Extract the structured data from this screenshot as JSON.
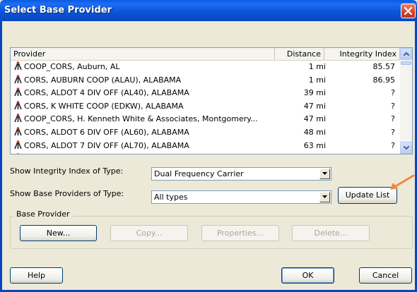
{
  "window": {
    "title": "Select Base Provider"
  },
  "list": {
    "columns": [
      "Provider",
      "Distance",
      "Integrity Index"
    ],
    "rows": [
      {
        "provider": "COOP_CORS, Auburn, AL",
        "distance": "1 mi",
        "integrity": "85.57"
      },
      {
        "provider": "CORS, AUBURN COOP (ALAU),  ALABAMA",
        "distance": "1 mi",
        "integrity": "86.95"
      },
      {
        "provider": "CORS, ALDOT 4 DIV OFF (AL40),  ALABAMA",
        "distance": "39 mi",
        "integrity": "?"
      },
      {
        "provider": "CORS, K WHITE COOP (EDKW),  ALABAMA",
        "distance": "47 mi",
        "integrity": "?"
      },
      {
        "provider": "COOP_CORS, H. Kenneth White & Associates, Montgomery...",
        "distance": "47 mi",
        "integrity": "?"
      },
      {
        "provider": "CORS, ALDOT 6 DIV OFF (AL60),  ALABAMA",
        "distance": "48 mi",
        "integrity": "?"
      },
      {
        "provider": "CORS, ALDOT 7 DIV OFF (AL70),  ALABAMA",
        "distance": "63 mi",
        "integrity": "?"
      }
    ]
  },
  "filters": {
    "integrity_label": "Show Integrity Index of Type:",
    "integrity_value": "Dual Frequency Carrier",
    "providers_label": "Show Base Providers of Type:",
    "providers_value": "All types",
    "update_button": "Update List"
  },
  "base_provider": {
    "group_label": "Base Provider",
    "new_button": "New...",
    "copy_button": "Copy...",
    "properties_button": "Properties...",
    "delete_button": "Delete..."
  },
  "footer": {
    "help_button": "Help",
    "ok_button": "OK",
    "cancel_button": "Cancel"
  },
  "colors": {
    "titlebar": "#0A5BE4",
    "dialog_bg": "#ECE9D8",
    "close_button": "#D2442B",
    "annotation_arrow": "#F0883C"
  },
  "icons": {
    "provider": "gps-antenna-icon",
    "close": "close-icon"
  }
}
